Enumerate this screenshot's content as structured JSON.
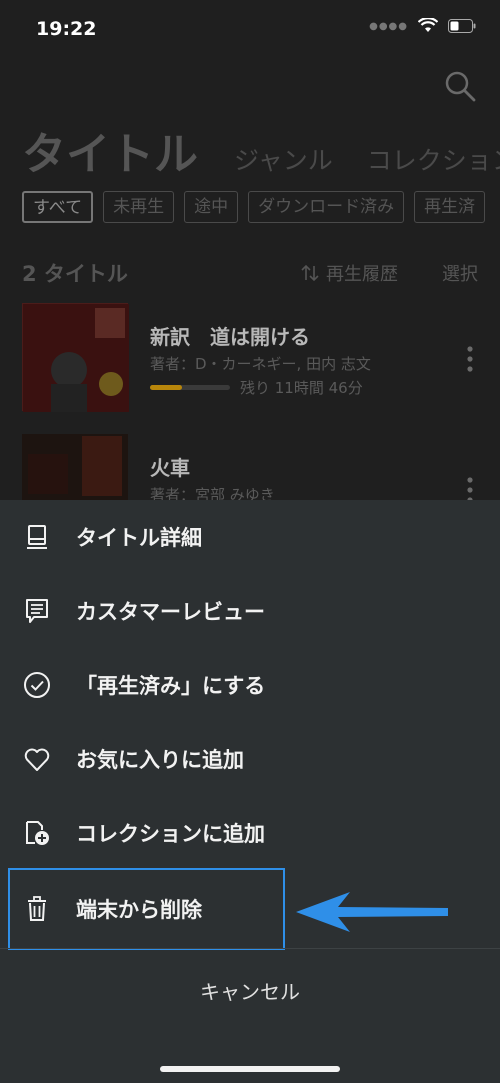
{
  "status": {
    "time": "19:22"
  },
  "tabs": {
    "main": "タイトル",
    "genre": "ジャンル",
    "collection": "コレクション"
  },
  "filters": [
    "すべて",
    "未再生",
    "途中",
    "ダウンロード済み",
    "再生済"
  ],
  "list": {
    "count": "2 タイトル",
    "sort_label": "再生履歴",
    "select_label": "選択"
  },
  "books": [
    {
      "title": "新訳　道は開ける",
      "author": "著者：D・カーネギー, 田内 志文",
      "progress": 0.4,
      "remaining": "残り 11時間 46分"
    },
    {
      "title": "火車",
      "author": "著者：宮部 みゆき"
    }
  ],
  "sheet": {
    "items": [
      {
        "label": "タイトル詳細",
        "icon": "book-icon"
      },
      {
        "label": "カスタマーレビュー",
        "icon": "review-icon"
      },
      {
        "label": "「再生済み」にする",
        "icon": "check-circle-icon"
      },
      {
        "label": "お気に入りに追加",
        "icon": "heart-icon"
      },
      {
        "label": "コレクションに追加",
        "icon": "collection-add-icon"
      },
      {
        "label": "端末から削除",
        "icon": "trash-icon"
      }
    ],
    "cancel": "キャンセル"
  },
  "colors": {
    "highlight": "#2f8fe8",
    "progress": "#b8860b",
    "sheet_bg": "#2c3032"
  }
}
